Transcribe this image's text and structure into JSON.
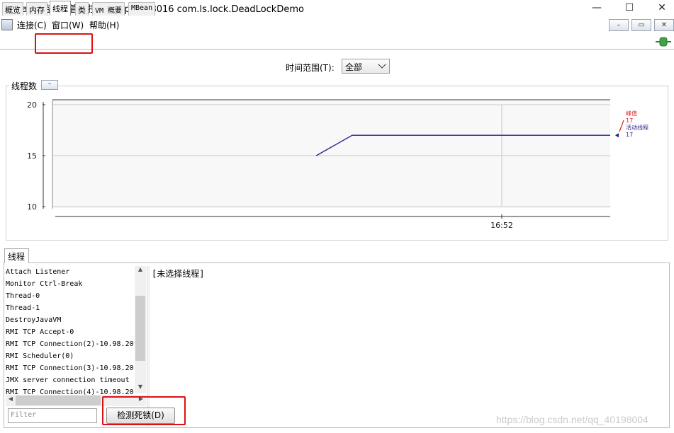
{
  "window": {
    "title": "Java 监视和管理控制台 - pid: 18016 com.ls.lock.DeadLockDemo",
    "minimize": "—",
    "maximize": "☐",
    "close": "✕"
  },
  "menu": {
    "items": [
      "连接(C)",
      "窗口(W)",
      "帮助(H)"
    ],
    "inner_buttons": [
      "–",
      "▭",
      "✕"
    ]
  },
  "tabs": [
    {
      "label": "概览",
      "selected": false
    },
    {
      "label": "内存",
      "selected": false
    },
    {
      "label": "线程",
      "selected": true
    },
    {
      "label": "类",
      "selected": false
    },
    {
      "label": "VM 概要",
      "selected": false
    },
    {
      "label": "MBean",
      "selected": false
    }
  ],
  "time_range": {
    "label": "时间范围(T):",
    "value": "全部"
  },
  "chart_panel": {
    "title": "线程数",
    "collapse": "⌃"
  },
  "chart_data": {
    "type": "line",
    "ylim": [
      10,
      20
    ],
    "yticks": [
      "20",
      "15",
      "10"
    ],
    "xticks": [
      "16:52"
    ],
    "series": [
      {
        "name": "活动线程",
        "color": "#2b1e8c",
        "points": [
          [
            0.473,
            15
          ],
          [
            0.5375,
            17
          ],
          [
            1.0,
            17
          ]
        ]
      }
    ],
    "legend": [
      {
        "label": "峰值",
        "value": "17",
        "color": "#e02020"
      },
      {
        "label": "活动线程",
        "value": "17",
        "color": "#2b1e8c"
      }
    ]
  },
  "threads_tab": {
    "label": "线程",
    "items": [
      "Attach Listener",
      "Monitor Ctrl-Break",
      "Thread-0",
      "Thread-1",
      "DestroyJavaVM",
      "RMI TCP Accept-0",
      "RMI TCP Connection(2)-10.98.20",
      "RMI Scheduler(0)",
      "RMI TCP Connection(3)-10.98.20",
      "JMX server connection timeout",
      "RMI TCP Connection(4)-10.98.20"
    ],
    "detail": "[未选择线程]",
    "filter_placeholder": "Filter",
    "detect_button": "检测死锁(D)"
  },
  "watermark": "https://blog.csdn.net/qq_40198004"
}
